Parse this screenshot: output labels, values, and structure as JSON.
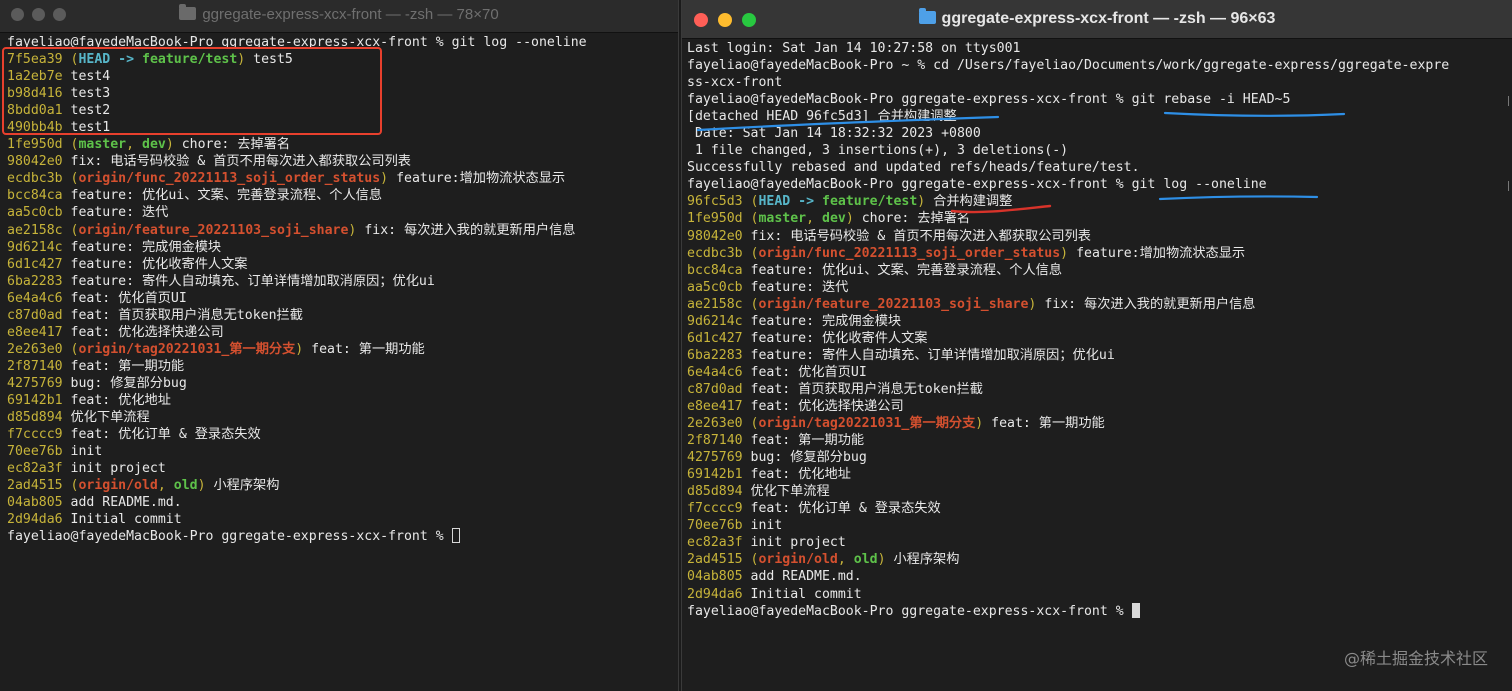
{
  "left_window": {
    "title": "ggregate-express-xcx-front — -zsh — 78×70",
    "lines": [
      [
        {
          "t": "fayeliao@fayedeMacBook-Pro ggregate-express-xcx-front % git log --oneline",
          "c": "text"
        }
      ],
      [
        {
          "t": "7f5ea39",
          "c": "hash"
        },
        {
          "t": " (",
          "c": "lp"
        },
        {
          "t": "HEAD -> ",
          "c": "head"
        },
        {
          "t": "feature/test",
          "c": "br"
        },
        {
          "t": ")",
          "c": "rp"
        },
        {
          "t": " test5",
          "c": "text"
        }
      ],
      [
        {
          "t": "1a2eb7e",
          "c": "hash"
        },
        {
          "t": " test4",
          "c": "text"
        }
      ],
      [
        {
          "t": "b98d416",
          "c": "hash"
        },
        {
          "t": " test3",
          "c": "text"
        }
      ],
      [
        {
          "t": "8bdd0a1",
          "c": "hash"
        },
        {
          "t": " test2",
          "c": "text"
        }
      ],
      [
        {
          "t": "490bb4b",
          "c": "hash"
        },
        {
          "t": " test1",
          "c": "text"
        }
      ],
      [
        {
          "t": "1fe950d",
          "c": "hash"
        },
        {
          "t": " (",
          "c": "lp"
        },
        {
          "t": "master",
          "c": "br"
        },
        {
          "t": ", ",
          "c": "lp"
        },
        {
          "t": "dev",
          "c": "br"
        },
        {
          "t": ")",
          "c": "rp"
        },
        {
          "t": " chore: 去掉署名",
          "c": "text"
        }
      ],
      [
        {
          "t": "98042e0",
          "c": "hash"
        },
        {
          "t": " fix: 电话号码校验 & 首页不用每次进入都获取公司列表",
          "c": "text"
        }
      ],
      [
        {
          "t": "ecdbc3b",
          "c": "hash"
        },
        {
          "t": " (",
          "c": "lp"
        },
        {
          "t": "origin/func_20221113_soji_order_status",
          "c": "rm"
        },
        {
          "t": ")",
          "c": "rp"
        },
        {
          "t": " feature:增加物流状态显示",
          "c": "text"
        }
      ],
      [
        {
          "t": "bcc84ca",
          "c": "hash"
        },
        {
          "t": " feature: 优化ui、文案、完善登录流程、个人信息",
          "c": "text"
        }
      ],
      [
        {
          "t": "aa5c0cb",
          "c": "hash"
        },
        {
          "t": " feature: 迭代",
          "c": "text"
        }
      ],
      [
        {
          "t": "ae2158c",
          "c": "hash"
        },
        {
          "t": " (",
          "c": "lp"
        },
        {
          "t": "origin/feature_20221103_soji_share",
          "c": "rm"
        },
        {
          "t": ")",
          "c": "rp"
        },
        {
          "t": " fix: 每次进入我的就更新用户信息",
          "c": "text"
        }
      ],
      [
        {
          "t": "9d6214c",
          "c": "hash"
        },
        {
          "t": " feature: 完成佣金模块",
          "c": "text"
        }
      ],
      [
        {
          "t": "6d1c427",
          "c": "hash"
        },
        {
          "t": " feature: 优化收寄件人文案",
          "c": "text"
        }
      ],
      [
        {
          "t": "6ba2283",
          "c": "hash"
        },
        {
          "t": " feature: 寄件人自动填充、订单详情增加取消原因；优化ui",
          "c": "text"
        }
      ],
      [
        {
          "t": "6e4a4c6",
          "c": "hash"
        },
        {
          "t": " feat: 优化首页UI",
          "c": "text"
        }
      ],
      [
        {
          "t": "c87d0ad",
          "c": "hash"
        },
        {
          "t": " feat: 首页获取用户消息无token拦截",
          "c": "text"
        }
      ],
      [
        {
          "t": "e8ee417",
          "c": "hash"
        },
        {
          "t": " feat: 优化选择快递公司",
          "c": "text"
        }
      ],
      [
        {
          "t": "2e263e0",
          "c": "hash"
        },
        {
          "t": " (",
          "c": "lp"
        },
        {
          "t": "origin/tag20221031_第一期分支",
          "c": "rm"
        },
        {
          "t": ")",
          "c": "rp"
        },
        {
          "t": " feat: 第一期功能",
          "c": "text"
        }
      ],
      [
        {
          "t": "2f87140",
          "c": "hash"
        },
        {
          "t": " feat: 第一期功能",
          "c": "text"
        }
      ],
      [
        {
          "t": "4275769",
          "c": "hash"
        },
        {
          "t": " bug: 修复部分bug",
          "c": "text"
        }
      ],
      [
        {
          "t": "69142b1",
          "c": "hash"
        },
        {
          "t": " feat: 优化地址",
          "c": "text"
        }
      ],
      [
        {
          "t": "d85d894",
          "c": "hash"
        },
        {
          "t": " 优化下单流程",
          "c": "text"
        }
      ],
      [
        {
          "t": "f7cccc9",
          "c": "hash"
        },
        {
          "t": " feat: 优化订单 & 登录态失效",
          "c": "text"
        }
      ],
      [
        {
          "t": "70ee76b",
          "c": "hash"
        },
        {
          "t": " init",
          "c": "text"
        }
      ],
      [
        {
          "t": "ec82a3f",
          "c": "hash"
        },
        {
          "t": " init project",
          "c": "text"
        }
      ],
      [
        {
          "t": "2ad4515",
          "c": "hash"
        },
        {
          "t": " (",
          "c": "lp"
        },
        {
          "t": "origin/old",
          "c": "rm"
        },
        {
          "t": ", ",
          "c": "lp"
        },
        {
          "t": "old",
          "c": "br"
        },
        {
          "t": ")",
          "c": "rp"
        },
        {
          "t": " 小程序架构",
          "c": "text"
        }
      ],
      [
        {
          "t": "04ab805",
          "c": "hash"
        },
        {
          "t": " add README.md.",
          "c": "text"
        }
      ],
      [
        {
          "t": "2d94da6",
          "c": "hash"
        },
        {
          "t": " Initial commit",
          "c": "text"
        }
      ],
      [
        {
          "t": "fayeliao@fayedeMacBook-Pro ggregate-express-xcx-front % ",
          "c": "text"
        },
        {
          "t": "",
          "c": "cursor-outline"
        }
      ]
    ]
  },
  "right_window": {
    "title": "ggregate-express-xcx-front — -zsh — 96×63",
    "lines": [
      [
        {
          "t": "Last login: Sat Jan 14 10:27:58 on ttys001",
          "c": "text"
        }
      ],
      [
        {
          "t": "fayeliao@fayedeMacBook-Pro ~ % cd /Users/fayeliao/Documents/work/ggregate-express/ggregate-expre",
          "c": "text"
        }
      ],
      [
        {
          "t": "ss-xcx-front",
          "c": "text"
        }
      ],
      [
        {
          "t": "fayeliao@fayedeMacBook-Pro ggregate-express-xcx-front % git rebase -i HEAD~5",
          "c": "text"
        }
      ],
      [
        {
          "t": "[detached HEAD 96fc5d3] 合并构建调整",
          "c": "text"
        }
      ],
      [
        {
          "t": " Date: Sat Jan 14 18:32:32 2023 +0800",
          "c": "text"
        }
      ],
      [
        {
          "t": " 1 file changed, 3 insertions(+), 3 deletions(-)",
          "c": "text"
        }
      ],
      [
        {
          "t": "Successfully rebased and updated refs/heads/feature/test.",
          "c": "text"
        }
      ],
      [
        {
          "t": "fayeliao@fayedeMacBook-Pro ggregate-express-xcx-front % git log --oneline",
          "c": "text"
        }
      ],
      [
        {
          "t": "96fc5d3",
          "c": "hash"
        },
        {
          "t": " (",
          "c": "lp"
        },
        {
          "t": "HEAD -> ",
          "c": "head"
        },
        {
          "t": "feature/test",
          "c": "br"
        },
        {
          "t": ")",
          "c": "rp"
        },
        {
          "t": " 合并构建调整",
          "c": "text"
        }
      ],
      [
        {
          "t": "1fe950d",
          "c": "hash"
        },
        {
          "t": " (",
          "c": "lp"
        },
        {
          "t": "master",
          "c": "br"
        },
        {
          "t": ", ",
          "c": "lp"
        },
        {
          "t": "dev",
          "c": "br"
        },
        {
          "t": ")",
          "c": "rp"
        },
        {
          "t": " chore: 去掉署名",
          "c": "text"
        }
      ],
      [
        {
          "t": "98042e0",
          "c": "hash"
        },
        {
          "t": " fix: 电话号码校验 & 首页不用每次进入都获取公司列表",
          "c": "text"
        }
      ],
      [
        {
          "t": "ecdbc3b",
          "c": "hash"
        },
        {
          "t": " (",
          "c": "lp"
        },
        {
          "t": "origin/func_20221113_soji_order_status",
          "c": "rm"
        },
        {
          "t": ")",
          "c": "rp"
        },
        {
          "t": " feature:增加物流状态显示",
          "c": "text"
        }
      ],
      [
        {
          "t": "bcc84ca",
          "c": "hash"
        },
        {
          "t": " feature: 优化ui、文案、完善登录流程、个人信息",
          "c": "text"
        }
      ],
      [
        {
          "t": "aa5c0cb",
          "c": "hash"
        },
        {
          "t": " feature: 迭代",
          "c": "text"
        }
      ],
      [
        {
          "t": "ae2158c",
          "c": "hash"
        },
        {
          "t": " (",
          "c": "lp"
        },
        {
          "t": "origin/feature_20221103_soji_share",
          "c": "rm"
        },
        {
          "t": ")",
          "c": "rp"
        },
        {
          "t": " fix: 每次进入我的就更新用户信息",
          "c": "text"
        }
      ],
      [
        {
          "t": "9d6214c",
          "c": "hash"
        },
        {
          "t": " feature: 完成佣金模块",
          "c": "text"
        }
      ],
      [
        {
          "t": "6d1c427",
          "c": "hash"
        },
        {
          "t": " feature: 优化收寄件人文案",
          "c": "text"
        }
      ],
      [
        {
          "t": "6ba2283",
          "c": "hash"
        },
        {
          "t": " feature: 寄件人自动填充、订单详情增加取消原因；优化ui",
          "c": "text"
        }
      ],
      [
        {
          "t": "6e4a4c6",
          "c": "hash"
        },
        {
          "t": " feat: 优化首页UI",
          "c": "text"
        }
      ],
      [
        {
          "t": "c87d0ad",
          "c": "hash"
        },
        {
          "t": " feat: 首页获取用户消息无token拦截",
          "c": "text"
        }
      ],
      [
        {
          "t": "e8ee417",
          "c": "hash"
        },
        {
          "t": " feat: 优化选择快递公司",
          "c": "text"
        }
      ],
      [
        {
          "t": "2e263e0",
          "c": "hash"
        },
        {
          "t": " (",
          "c": "lp"
        },
        {
          "t": "origin/tag20221031_第一期分支",
          "c": "rm"
        },
        {
          "t": ")",
          "c": "rp"
        },
        {
          "t": " feat: 第一期功能",
          "c": "text"
        }
      ],
      [
        {
          "t": "2f87140",
          "c": "hash"
        },
        {
          "t": " feat: 第一期功能",
          "c": "text"
        }
      ],
      [
        {
          "t": "4275769",
          "c": "hash"
        },
        {
          "t": " bug: 修复部分bug",
          "c": "text"
        }
      ],
      [
        {
          "t": "69142b1",
          "c": "hash"
        },
        {
          "t": " feat: 优化地址",
          "c": "text"
        }
      ],
      [
        {
          "t": "d85d894",
          "c": "hash"
        },
        {
          "t": " 优化下单流程",
          "c": "text"
        }
      ],
      [
        {
          "t": "f7cccc9",
          "c": "hash"
        },
        {
          "t": " feat: 优化订单 & 登录态失效",
          "c": "text"
        }
      ],
      [
        {
          "t": "70ee76b",
          "c": "hash"
        },
        {
          "t": " init",
          "c": "text"
        }
      ],
      [
        {
          "t": "ec82a3f",
          "c": "hash"
        },
        {
          "t": " init project",
          "c": "text"
        }
      ],
      [
        {
          "t": "2ad4515",
          "c": "hash"
        },
        {
          "t": " (",
          "c": "lp"
        },
        {
          "t": "origin/old",
          "c": "rm"
        },
        {
          "t": ", ",
          "c": "lp"
        },
        {
          "t": "old",
          "c": "br"
        },
        {
          "t": ")",
          "c": "rp"
        },
        {
          "t": " 小程序架构",
          "c": "text"
        }
      ],
      [
        {
          "t": "04ab805",
          "c": "hash"
        },
        {
          "t": " add README.md.",
          "c": "text"
        }
      ],
      [
        {
          "t": "2d94da6",
          "c": "hash"
        },
        {
          "t": " Initial commit",
          "c": "text"
        }
      ],
      [
        {
          "t": "fayeliao@fayedeMacBook-Pro ggregate-express-xcx-front % ",
          "c": "text"
        },
        {
          "t": "",
          "c": "cursor-solid"
        }
      ]
    ]
  },
  "watermark": "@稀土掘金技术社区",
  "colors": {
    "hash": "#c7b43a",
    "head": "#57b6c9",
    "branch": "#5ec24a",
    "remote": "#d4502f",
    "highlight_box": "#e8402d",
    "underline_blue": "#2e8fe6",
    "underline_red": "#d8332a",
    "light_close": "#ff5f57",
    "light_minimize": "#febc2e",
    "light_zoom": "#28c840"
  }
}
